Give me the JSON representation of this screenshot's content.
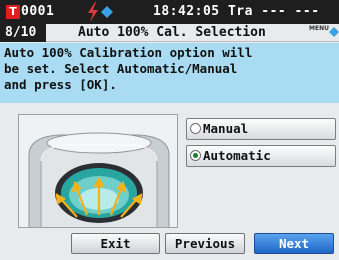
{
  "status_bar": {
    "code": "0001",
    "time_text": "18:42:05 Tra --- ---",
    "icons": [
      "target-t-icon",
      "bolt-icon",
      "diamond-icon"
    ]
  },
  "title_bar": {
    "page_count": "8/10",
    "title": "Auto 100% Cal. Selection",
    "menu_label": "MENU"
  },
  "message": {
    "text": "Auto 100% Calibration option will\nbe set. Select Automatic/Manual\nand press [OK]."
  },
  "options": [
    {
      "label": "Manual",
      "selected": false
    },
    {
      "label": "Automatic",
      "selected": true
    }
  ],
  "buttons": {
    "exit": "Exit",
    "previous": "Previous",
    "next": "Next"
  },
  "colors": {
    "status_bar_bg": "#1e1e1e",
    "message_bg": "#a9dcf2",
    "selected_radio": "#1f7f2a",
    "next_button": "#1f67c8",
    "arrows": "#f2b21c"
  }
}
